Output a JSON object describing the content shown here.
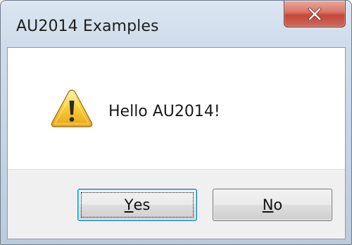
{
  "window": {
    "title": "AU2014 Examples"
  },
  "message": {
    "text": "Hello AU2014!",
    "icon": "warning-icon"
  },
  "buttons": {
    "yes": {
      "mnemonic": "Y",
      "rest": "es"
    },
    "no": {
      "mnemonic": "N",
      "rest": "o"
    }
  },
  "colors": {
    "close_button": "#c4473a",
    "default_button_border": "#3c7fb1",
    "warning_fill": "#f5c518"
  }
}
